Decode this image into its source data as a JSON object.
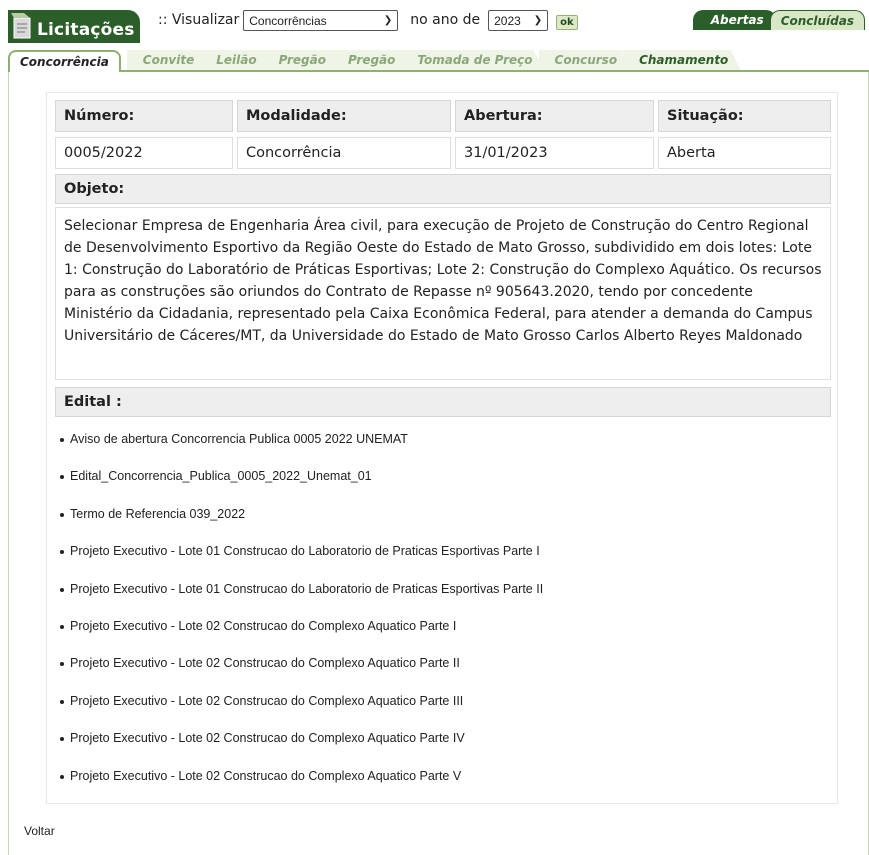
{
  "header": {
    "app_title": "Licitações",
    "visualizar_label": ":: Visualizar",
    "visualizar_selected": "Concorrências",
    "ano_label": "no ano de",
    "ano_selected": "2023",
    "ok_label": "ok"
  },
  "status_tabs": [
    {
      "label": "Abertas",
      "active": true
    },
    {
      "label": "Concluídas",
      "active": false
    }
  ],
  "modality_tabs": [
    {
      "label": "Concorrência",
      "active": true
    },
    {
      "label": "Convite"
    },
    {
      "label": "Leilão"
    },
    {
      "label": "Pregão"
    },
    {
      "label": "Pregão"
    },
    {
      "label": "Tomada de Preço"
    },
    {
      "label": "Concurso"
    },
    {
      "label": "Chamamento"
    }
  ],
  "details": {
    "numero_label": "Número:",
    "modalidade_label": "Modalidade:",
    "abertura_label": "Abertura:",
    "situacao_label": "Situação:",
    "numero": "0005/2022",
    "modalidade": "Concorrência",
    "abertura": "31/01/2023",
    "situacao": "Aberta"
  },
  "objeto": {
    "label": "Objeto:",
    "text": "Selecionar Empresa de Engenharia Área civil, para execução de Projeto de Construção do Centro Regional de Desenvolvimento Esportivo da Região Oeste do Estado de Mato Grosso, subdividido em dois lotes: Lote 1: Construção do Laboratório de Práticas Esportivas; Lote 2: Construção do Complexo Aquático. Os recursos para as construções são oriundos do Contrato de Repasse nº 905643.2020, tendo por concedente Ministério da Cidadania, representado pela Caixa Econômica Federal, para atender a demanda do Campus Universitário de Cáceres/MT, da Universidade do Estado de Mato Grosso Carlos Alberto Reyes Maldonado"
  },
  "edital": {
    "label": "Edital :",
    "documents": [
      "Aviso de abertura Concorrencia Publica 0005 2022 UNEMAT",
      "Edital_Concorrencia_Publica_0005_2022_Unemat_01",
      "Termo de Referencia 039_2022",
      "Projeto Executivo - Lote 01 Construcao do Laboratorio de Praticas Esportivas Parte I",
      "Projeto Executivo - Lote 01 Construcao do Laboratorio de Praticas Esportivas Parte II",
      "Projeto Executivo - Lote 02 Construcao do Complexo Aquatico Parte I",
      "Projeto Executivo - Lote 02 Construcao do Complexo Aquatico Parte II",
      "Projeto Executivo - Lote 02 Construcao do Complexo Aquatico Parte III",
      "Projeto Executivo - Lote 02 Construcao do Complexo Aquatico Parte IV",
      "Projeto Executivo - Lote 02 Construcao do Complexo Aquatico Parte V"
    ]
  },
  "footer": {
    "voltar_label": "Voltar"
  },
  "colors": {
    "brand_green": "#2c5e2a",
    "tab_border": "#8fb071",
    "header_cell_bg": "#eeeeee"
  }
}
